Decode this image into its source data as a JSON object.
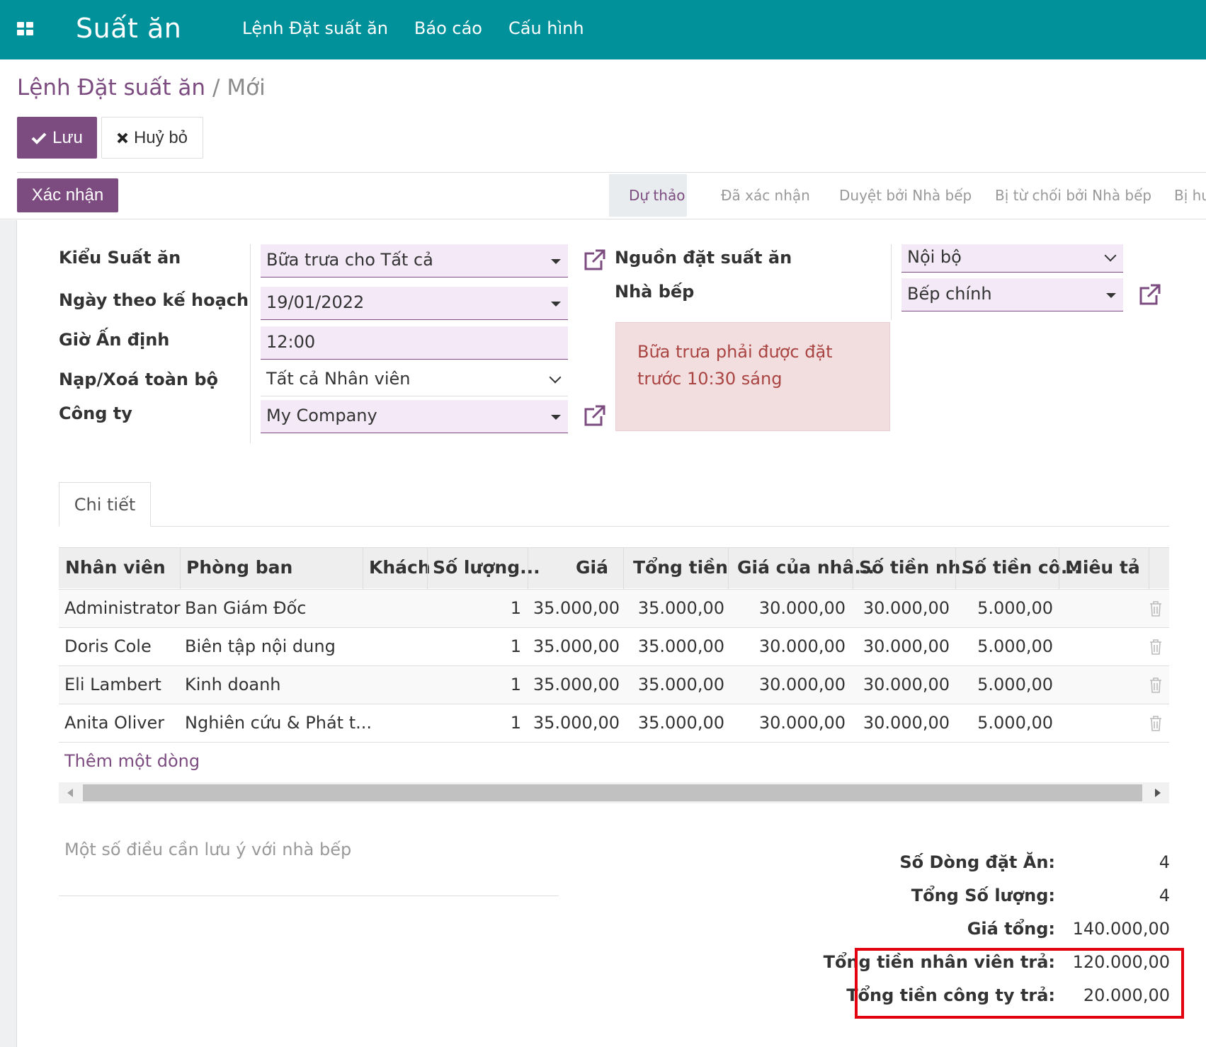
{
  "navbar": {
    "app_title": "Suất ăn",
    "menu": [
      "Lệnh Đặt suất ăn",
      "Báo cáo",
      "Cấu hình"
    ]
  },
  "breadcrumb": {
    "parent": "Lệnh Đặt suất ăn",
    "separator": "/",
    "current": "Mới"
  },
  "buttons": {
    "save": "Lưu",
    "cancel": "Huỷ bỏ",
    "confirm": "Xác nhận"
  },
  "stages": [
    "Dự thảo",
    "Đã xác nhận",
    "Duyệt bởi Nhà bếp",
    "Bị từ chối bởi Nhà bếp",
    "Bị hu"
  ],
  "active_stage": "Dự thảo",
  "form": {
    "meal_type": {
      "label": "Kiểu Suất ăn",
      "value": "Bữa trưa cho Tất cả"
    },
    "planned_date": {
      "label": "Ngày theo kế hoạch",
      "value": "19/01/2022"
    },
    "meal_time": {
      "label": "Giờ Ấn định",
      "value": "12:00"
    },
    "load_remove_all": {
      "label": "Nạp/Xoá toàn bộ",
      "value": "Tất cả Nhân viên"
    },
    "company": {
      "label": "Công ty",
      "value": "My Company"
    },
    "order_source": {
      "label": "Nguồn đặt suất ăn",
      "value": "Nội bộ"
    },
    "kitchen": {
      "label": "Nhà bếp",
      "value": "Bếp chính"
    },
    "alert": "Bữa trưa phải được đặt trước 10:30 sáng"
  },
  "tabs": [
    "Chi tiết"
  ],
  "table": {
    "headers": [
      "Nhân viên",
      "Phòng ban",
      "Khách",
      "Số lượng...",
      "Giá",
      "Tổng tiền",
      "Giá của nhâ...",
      "Số tiền nh...",
      "Số tiền cô...",
      "Miêu tả"
    ],
    "rows": [
      [
        "Administrator",
        "Ban Giám Đốc",
        "",
        "1",
        "35.000,00",
        "35.000,00",
        "30.000,00",
        "30.000,00",
        "5.000,00",
        ""
      ],
      [
        "Doris Cole",
        "Biên tập nội dung",
        "",
        "1",
        "35.000,00",
        "35.000,00",
        "30.000,00",
        "30.000,00",
        "5.000,00",
        ""
      ],
      [
        "Eli Lambert",
        "Kinh doanh",
        "",
        "1",
        "35.000,00",
        "35.000,00",
        "30.000,00",
        "30.000,00",
        "5.000,00",
        ""
      ],
      [
        "Anita Oliver",
        "Nghiên cứu & Phát t...",
        "",
        "1",
        "35.000,00",
        "35.000,00",
        "30.000,00",
        "30.000,00",
        "5.000,00",
        ""
      ]
    ],
    "add_line": "Thêm một dòng"
  },
  "note_placeholder": "Một số điều cần lưu ý với nhà bếp",
  "totals": [
    {
      "label": "Số Dòng đặt Ăn:",
      "value": "4"
    },
    {
      "label": "Tổng Số lượng:",
      "value": "4"
    },
    {
      "label": "Giá tổng:",
      "value": "140.000,00"
    },
    {
      "label": "Tổng tiền nhân viên trả:",
      "value": "120.000,00"
    },
    {
      "label": "Tổng tiền công ty trả:",
      "value": "20.000,00"
    }
  ],
  "colors": {
    "navbar": "#00919a",
    "primary": "#7c4c80",
    "highlight_box": "#e3000f",
    "alert_bg": "#f2dede",
    "alert_text": "#a94442"
  }
}
